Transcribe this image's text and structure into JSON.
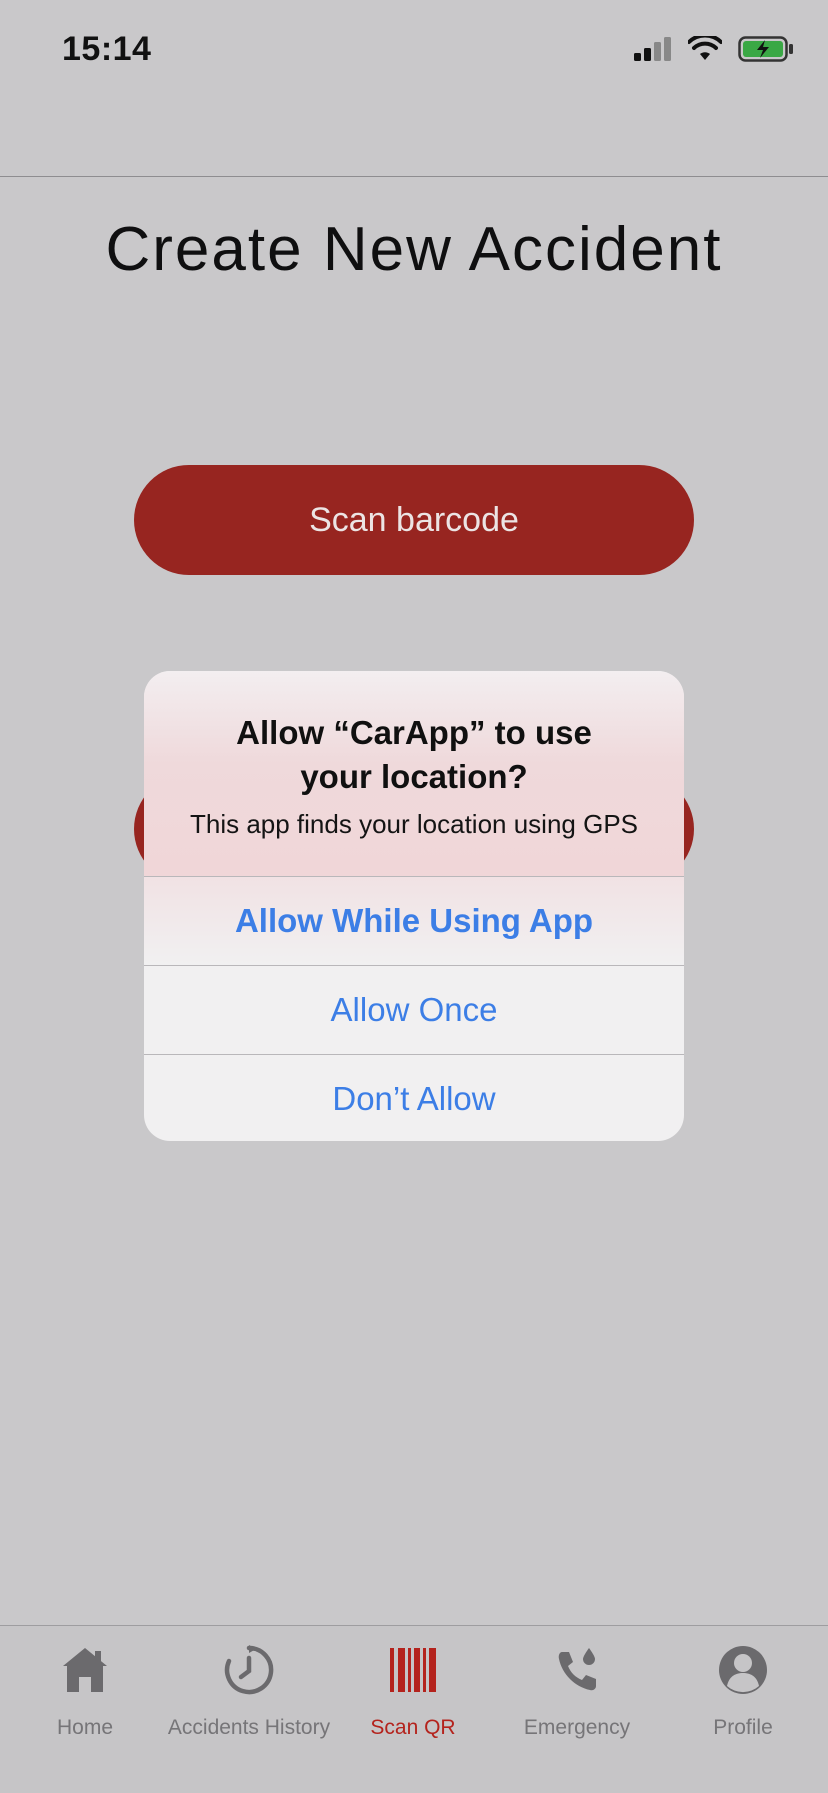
{
  "status_bar": {
    "time": "15:14"
  },
  "header": {
    "title": "Create New Accident"
  },
  "main": {
    "scan_button_label": "Scan barcode",
    "second_button_label": ""
  },
  "alert": {
    "title": "Allow “CarApp” to use your location?",
    "message": "This app finds your location using GPS",
    "buttons": [
      {
        "label": "Allow While Using App"
      },
      {
        "label": "Allow Once"
      },
      {
        "label": "Don’t Allow"
      }
    ]
  },
  "tabbar": {
    "active_index": 2,
    "accent_color": "#b4231d",
    "tabs": [
      {
        "label": "Home",
        "icon": "home-icon"
      },
      {
        "label": "Accidents History",
        "icon": "clock-icon"
      },
      {
        "label": "Scan QR",
        "icon": "barcode-icon"
      },
      {
        "label": "Emergency",
        "icon": "phone-icon"
      },
      {
        "label": "Profile",
        "icon": "person-icon"
      }
    ]
  },
  "colors": {
    "primary_button": "#972520",
    "alert_link": "#3c7ee6",
    "background": "#c9c8ca"
  }
}
